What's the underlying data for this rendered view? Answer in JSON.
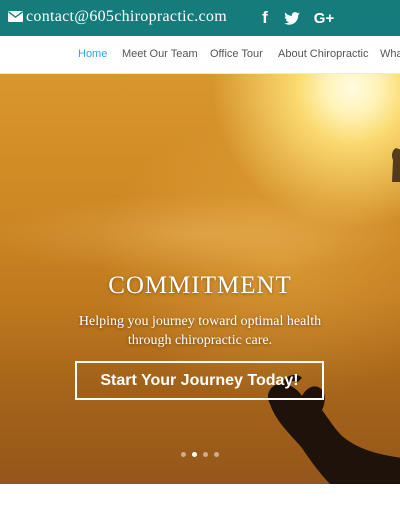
{
  "topbar": {
    "email": "contact@605chiropractic.com",
    "icons": [
      "envelope-icon",
      "facebook-icon",
      "twitter-icon",
      "google-plus-icon"
    ],
    "facebook_glyph": "f",
    "googleplus_glyph": "G+",
    "background": "#167b7b"
  },
  "nav": {
    "items": [
      "Home",
      "Meet Our Team",
      "Office Tour",
      "About Chiropractic",
      "Wha"
    ],
    "active_index": 0,
    "active_color": "#2ea3f2"
  },
  "hero": {
    "title": "COMMITMENT",
    "subtitle": "Helping you journey toward optimal health through chiropractic care.",
    "button_label": "Start Your Journey Today!",
    "slide_count": 4,
    "active_slide_index": 1
  }
}
